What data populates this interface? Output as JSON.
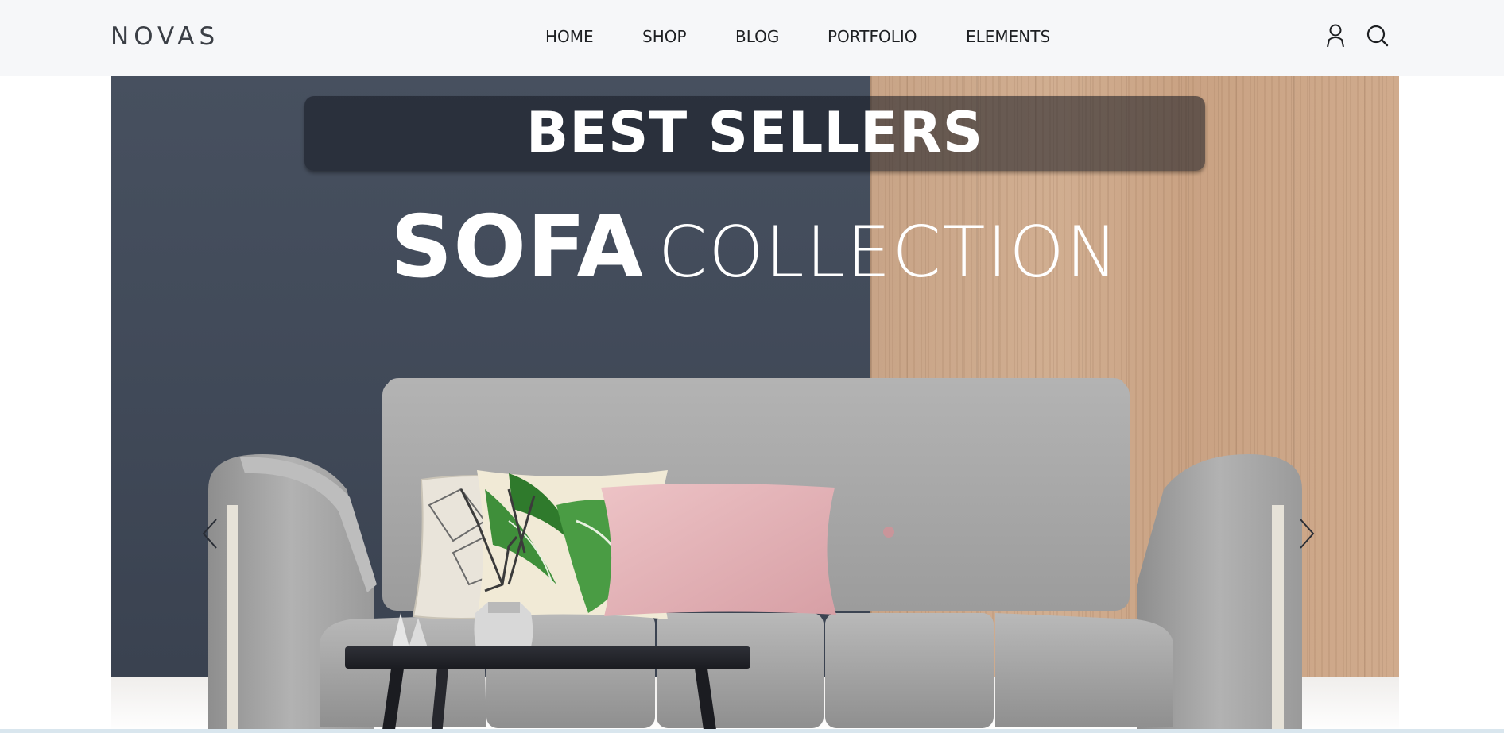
{
  "brand": {
    "logo_text": "NOVAS"
  },
  "nav": {
    "items": [
      {
        "label": "HOME"
      },
      {
        "label": "SHOP"
      },
      {
        "label": "BLOG"
      },
      {
        "label": "PORTFOLIO"
      },
      {
        "label": "ELEMENTS"
      }
    ]
  },
  "header_icons": {
    "account": "user-icon",
    "search": "search-icon"
  },
  "hero": {
    "banner": "BEST SELLERS",
    "headline_bold": "SOFA",
    "headline_light": "COLLECTION",
    "prev_icon": "chevron-left-icon",
    "next_icon": "chevron-right-icon"
  },
  "colors": {
    "header_bg": "#f6f7f9",
    "wall_dark": "#434c5b",
    "wall_wood": "#cca88b",
    "sofa": "#a9a9a9",
    "pillow_pink": "#e3b1b6",
    "pillow_leaf": "#3f8f3a",
    "table": "#23252b"
  }
}
